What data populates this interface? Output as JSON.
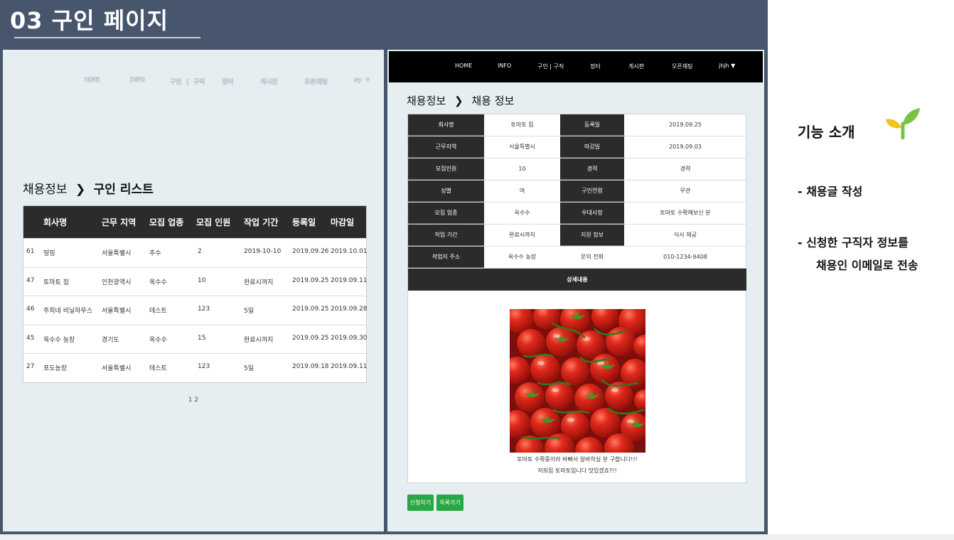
{
  "slide": {
    "title": "03 구인 페이지",
    "intro_title": "기능 소개",
    "intro_items": [
      "-  채용글 작성",
      "-  신청한 구직자 정보를",
      "채용인 이메일로 전송"
    ]
  },
  "left": {
    "ghost_nav": [
      "HOME",
      "INFO",
      "구인 | 구직",
      "정터",
      "게시판",
      "오픈채팅",
      "ay ▽"
    ],
    "breadcrumb_root": "채용정보",
    "breadcrumb_sep": "❯",
    "breadcrumb_leaf": "구인 리스트",
    "headers": [
      "회사명",
      "근무 지역",
      "모집 업종",
      "모집 인원",
      "작업 기간",
      "등록일",
      "마감일"
    ],
    "rows": [
      {
        "id": "61",
        "company": "띵띵",
        "region": "서울특별시",
        "job": "추수",
        "count": "2",
        "period": "2019-10-10",
        "reg": "2019.09.26",
        "due": "2019.10.01"
      },
      {
        "id": "47",
        "company": "토마토 집",
        "region": "인천광역시",
        "job": "옥수수",
        "count": "10",
        "period": "완료시까지",
        "reg": "2019.09.25",
        "due": "2019.09.11"
      },
      {
        "id": "46",
        "company": "주희네 비닐하우스",
        "region": "서울특별시",
        "job": "테스트",
        "count": "123",
        "period": "5일",
        "reg": "2019.09.25",
        "due": "2019.09.28"
      },
      {
        "id": "45",
        "company": "옥수수 농장",
        "region": "경기도",
        "job": "옥수수",
        "count": "15",
        "period": "완료시까지",
        "reg": "2019.09.25",
        "due": "2019.09.30"
      },
      {
        "id": "27",
        "company": "포도농장",
        "region": "서울특별시",
        "job": "테스트",
        "count": "123",
        "period": "5일",
        "reg": "2019.09.18",
        "due": "2019.09.11"
      }
    ],
    "pagination": "1 2"
  },
  "right": {
    "nav": [
      "HOME",
      "INFO",
      "구인 | 구직",
      "정터",
      "게시판",
      "오픈채팅",
      "jhjh ▼"
    ],
    "breadcrumb_root": "채용정보",
    "breadcrumb_sep": "❯",
    "breadcrumb_leaf": "채용 정보",
    "detail_rows": [
      {
        "l1": "회사명",
        "v1": "토마토 집",
        "l2": "등록일",
        "v2": "2019.09.25"
      },
      {
        "l1": "근무지역",
        "v1": "서울특별시",
        "l2": "마감일",
        "v2": "2019.09.03"
      },
      {
        "l1": "모집인원",
        "v1": "10",
        "l2": "경력",
        "v2": "경력"
      },
      {
        "l1": "성별",
        "v1": "여",
        "l2": "구인연령",
        "v2": "무관"
      },
      {
        "l1": "모집 업종",
        "v1": "옥수수",
        "l2": "우대사항",
        "v2": "토마토 수확해보신 분"
      },
      {
        "l1": "작업 기간",
        "v1": "완료시까지",
        "l2": "지원 정보",
        "v2": "식사 제공"
      },
      {
        "l1": "작업지 주소",
        "v1": "옥수수 농장",
        "l2": "문의 전화",
        "v2": "010-1234-9408"
      }
    ],
    "detail_header": "상세내용",
    "caption_line1": "토마토 수확중이라 바빠서 알바하실 분 구합니다!!!",
    "caption_line2": "저희집 토마토입니다 맛있겠죠?!!",
    "apply_button": "신청하기",
    "list_button": "목록가기"
  },
  "colors": {
    "frame": "#47566d",
    "panel": "#e6eef1",
    "header_dark": "#2b2b2b",
    "button_green": "#28a745",
    "tomato_red": "#d8261c",
    "sprout_green": "#7ac243"
  }
}
